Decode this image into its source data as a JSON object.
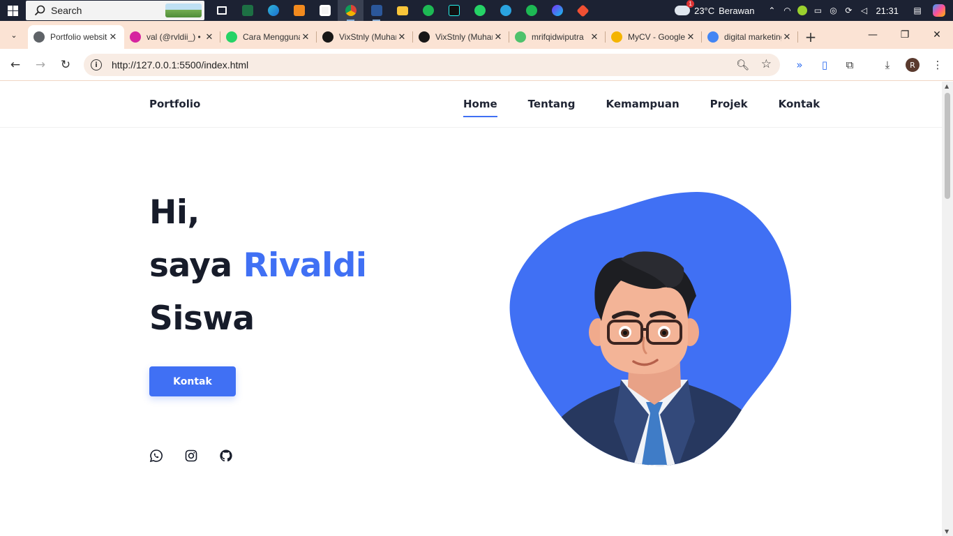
{
  "taskbar": {
    "search_label": "Search",
    "weather": {
      "temp": "23°C",
      "desc": "Berawan",
      "badge": "1"
    },
    "clock": "21:31"
  },
  "tabs": [
    {
      "title": "Portfolio website",
      "icon": "globe-icon",
      "color": "#5f6368"
    },
    {
      "title": "val (@rvldii_) • Instagram",
      "icon": "instagram-icon",
      "color": "#d6249f"
    },
    {
      "title": "Cara Menggunakan",
      "icon": "whatsapp-icon",
      "color": "#25d366"
    },
    {
      "title": "VixStnly (Muhammad)",
      "icon": "github-icon",
      "color": "#181717"
    },
    {
      "title": "VixStnly (Muhammad)",
      "icon": "github-icon",
      "color": "#181717"
    },
    {
      "title": "mrifqidwiputra",
      "icon": "asterisk-icon",
      "color": "#4ec26c"
    },
    {
      "title": "MyCV - Google Drive",
      "icon": "drive-icon",
      "color": "#f4b400"
    },
    {
      "title": "digital marketing",
      "icon": "google-icon",
      "color": "#4285f4"
    }
  ],
  "address": {
    "url": "http://127.0.0.1:5500/index.html",
    "profile_initial": "R"
  },
  "site": {
    "brand": "Portfolio",
    "menu": [
      "Home",
      "Tentang",
      "Kemampuan",
      "Projek",
      "Kontak"
    ],
    "hero": {
      "line1": "Hi,",
      "line2_prefix": "saya ",
      "name": "Rivaldi",
      "line3": "Siswa"
    },
    "cta": "Kontak",
    "accent": "#4070f4"
  }
}
